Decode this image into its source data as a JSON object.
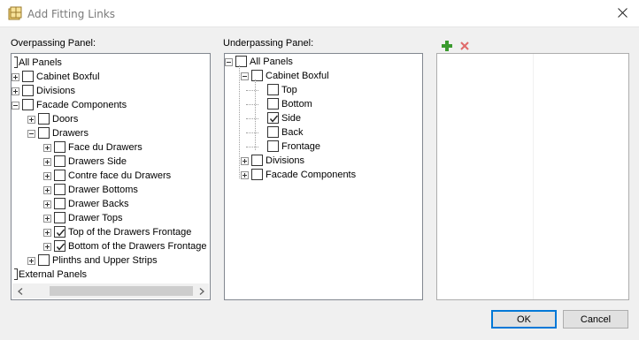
{
  "window": {
    "title": "Add Fitting Links",
    "icon": "cabinet-app-icon",
    "close_icon": "close-icon"
  },
  "overpassing": {
    "label": "Overpassing Panel:",
    "nodes": [
      {
        "label": "All Panels",
        "checked": false,
        "expander": "none"
      },
      {
        "label": "Cabinet Boxful",
        "checked": false,
        "expander": "plus"
      },
      {
        "label": "Divisions",
        "checked": false,
        "expander": "plus"
      },
      {
        "label": "Facade Components",
        "checked": false,
        "expander": "minus"
      },
      {
        "label": "Doors",
        "checked": false,
        "expander": "plus"
      },
      {
        "label": "Drawers",
        "checked": false,
        "expander": "minus"
      },
      {
        "label": "Face du Drawers",
        "checked": false,
        "expander": "plus"
      },
      {
        "label": "Drawers Side",
        "checked": false,
        "expander": "plus"
      },
      {
        "label": "Contre face du Drawers",
        "checked": false,
        "expander": "plus"
      },
      {
        "label": "Drawer Bottoms",
        "checked": false,
        "expander": "plus"
      },
      {
        "label": "Drawer Backs",
        "checked": false,
        "expander": "plus"
      },
      {
        "label": "Drawer Tops",
        "checked": false,
        "expander": "plus"
      },
      {
        "label": "Top of the Drawers Frontage",
        "checked": true,
        "expander": "plus"
      },
      {
        "label": "Bottom of the Drawers Frontage",
        "checked": true,
        "expander": "plus"
      },
      {
        "label": "Plinths and Upper Strips",
        "checked": false,
        "expander": "plus"
      },
      {
        "label": "External Panels",
        "checked": false,
        "expander": "none"
      }
    ]
  },
  "underpassing": {
    "label": "Underpassing Panel:",
    "nodes": [
      {
        "label": "All Panels",
        "checked": false,
        "expander": "minus"
      },
      {
        "label": "Cabinet Boxful",
        "checked": false,
        "expander": "minus"
      },
      {
        "label": "Top",
        "checked": false,
        "expander": "none"
      },
      {
        "label": "Bottom",
        "checked": false,
        "expander": "none"
      },
      {
        "label": "Side",
        "checked": true,
        "expander": "none"
      },
      {
        "label": "Back",
        "checked": false,
        "expander": "none"
      },
      {
        "label": "Frontage",
        "checked": false,
        "expander": "none"
      },
      {
        "label": "Divisions",
        "checked": false,
        "expander": "plus"
      },
      {
        "label": "Facade Components",
        "checked": false,
        "expander": "plus"
      }
    ]
  },
  "toolbar": {
    "add_icon": "add-plus-icon",
    "remove_icon": "remove-x-icon",
    "add_color": "#3a9a2e",
    "remove_color": "#e06a6a"
  },
  "buttons": {
    "ok": "OK",
    "cancel": "Cancel"
  }
}
